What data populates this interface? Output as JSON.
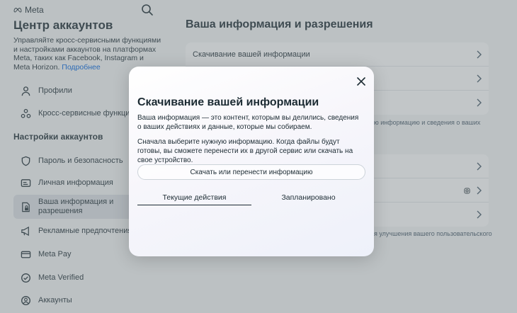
{
  "brand": {
    "name": "Meta"
  },
  "sidebar": {
    "title": "Центр аккаунтов",
    "description": "Управляйте кросс-сервисными функциями и настройками аккаунтов на платформах Meta, таких как Facebook, Instagram и Meta Horizon.",
    "more_link": "Подробнее",
    "top_items": [
      {
        "label": "Профили",
        "icon": "person-icon"
      },
      {
        "label": "Кросс-сервисные функции",
        "icon": "cross-services-icon"
      }
    ],
    "section_title": "Настройки аккаунтов",
    "items": [
      {
        "label": "Пароль и безопасность",
        "icon": "shield-icon"
      },
      {
        "label": "Личная информация",
        "icon": "id-card-icon"
      },
      {
        "label_line1": "Ваша информация и",
        "label_line2": "разрешения",
        "icon": "document-lock-icon"
      },
      {
        "label": "Рекламные предпочтения",
        "icon": "megaphone-icon"
      },
      {
        "label": "Meta Pay",
        "icon": "card-icon"
      },
      {
        "label": "Meta Verified",
        "icon": "verified-badge-icon"
      },
      {
        "label": "Аккаунты",
        "icon": "account-circle-icon"
      }
    ]
  },
  "main": {
    "title": "Ваша информация и разрешения",
    "card1_first_row": "Скачивание вашей информации",
    "note1": "ю информацию и сведения о ваших",
    "note2": "я улучшения вашего пользовательского"
  },
  "modal": {
    "title": "Скачивание вашей информации",
    "p1": "Ваша информация — это контент, которым вы делились, сведения о ваших действиях и данные, которые мы собираем.",
    "p2": "Сначала выберите нужную информацию. Когда файлы будут готовы, вы сможете перенести их в другой сервис или скачать на свое устройство.",
    "action_button": "Скачать или перенести информацию",
    "tabs": {
      "current": "Текущие действия",
      "planned": "Запланировано"
    }
  },
  "colors": {
    "accent": "#0064e0",
    "text": "#1c2b33",
    "overlay": "rgba(110,120,125,0.42)"
  }
}
